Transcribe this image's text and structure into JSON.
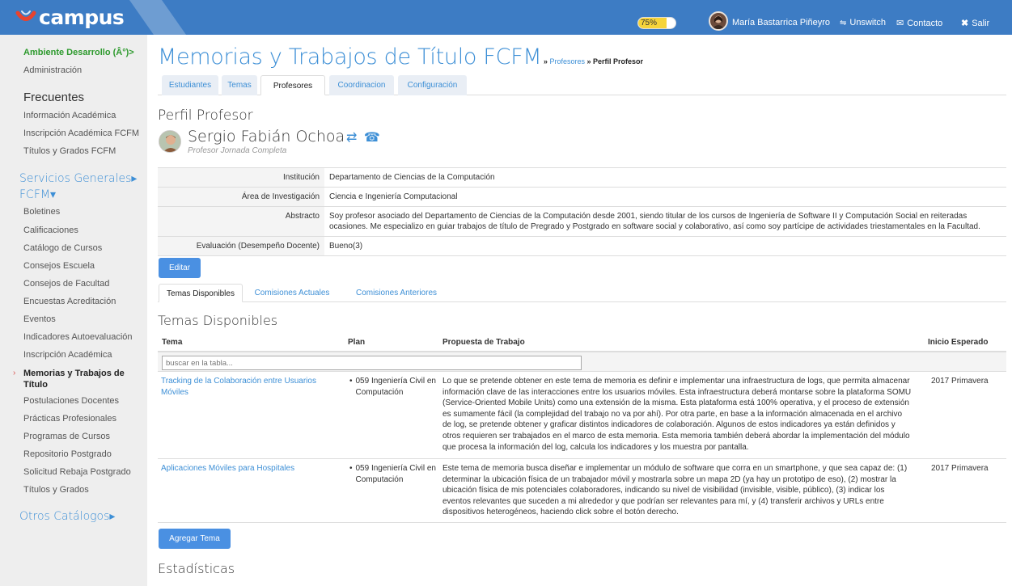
{
  "topbar": {
    "logo_text": "campus",
    "progress": {
      "label": "75%",
      "percent": 75
    },
    "user_name": "María Bastarrica Piñeyro",
    "unswitch_label": "Unswitch",
    "contact_label": "Contacto",
    "exit_label": "Salir",
    "colors": {
      "bar": "#3d7cc4",
      "progress": "#f6d43a"
    }
  },
  "sidebar": {
    "environment": "Ambiente Desarrollo (Â°)>",
    "admin": "Administración",
    "frecuentes_title": "Frecuentes",
    "frecuentes": [
      "Información Académica",
      "Inscripción Académica FCFM",
      "Títulos y Grados FCFM"
    ],
    "servicios_title_1": "Servicios Generales▸",
    "servicios_title_2": "FCFM▾",
    "servicios": [
      "Boletines",
      "Calificaciones",
      "Catálogo de Cursos",
      "Consejos Escuela",
      "Consejos de Facultad",
      "Encuestas Acreditación",
      "Eventos",
      "Indicadores Autoevaluación",
      "Inscripción Académica"
    ],
    "active_item_line1": "Memorias y Trabajos de",
    "active_item_line2": "Título",
    "servicios_after": [
      "Postulaciones Docentes",
      "Prácticas Profesionales",
      "Programas de Cursos",
      "Repositorio Postgrado",
      "Solicitud Rebaja Postgrado",
      "Títulos y Grados"
    ],
    "otros_title": "Otros Catálogos▸"
  },
  "page": {
    "title": "Memorias y Trabajos de Título FCFM",
    "breadcrumb_sep": " » ",
    "breadcrumb_link": "Profesores",
    "breadcrumb_current": "Perfil Profesor",
    "tabs": [
      "Estudiantes",
      "Temas",
      "Profesores",
      "Coordinacion",
      "Configuración"
    ],
    "active_tab": "Profesores"
  },
  "profile": {
    "heading": "Perfil Profesor",
    "name": "Sergio Fabián Ochoa",
    "role": "Profesor Jornada Completa",
    "fields": [
      {
        "label": "Institución",
        "value": "Departamento de Ciencias de la Computación"
      },
      {
        "label": "Área de Investigación",
        "value": "Ciencia e Ingeniería Computacional"
      },
      {
        "label": "Abstracto",
        "value": "Soy profesor asociado del Departamento de Ciencias de la Computación desde 2001, siendo titular de los cursos de Ingeniería de Software II y Computación Social en reiteradas ocasiones. Me especializo en guiar trabajos de título de Pregrado y Postgrado en software social y colaborativo, así como soy partícipe de actividades triestamentales en la Facultad."
      },
      {
        "label": "Evaluación (Desempeño Docente)",
        "value": "Bueno(3)"
      }
    ],
    "edit_label": "Editar"
  },
  "subtabs": [
    "Temas Disponibles",
    "Comisiones Actuales",
    "Comisiones Anteriores"
  ],
  "temas": {
    "heading": "Temas Disponibles",
    "columns": [
      "Tema",
      "Plan",
      "Propuesta de Trabajo",
      "Inicio Esperado"
    ],
    "search_placeholder": "buscar en la tabla...",
    "rows": [
      {
        "tema": "Tracking de la Colaboración entre Usuarios Móviles",
        "plan": "059 Ingeniería Civil en Computación",
        "propuesta": "Lo que se pretende obtener en este tema de memoria es definir e implementar una infraestructura de logs, que permita almacenar información clave de las interacciones entre los usuarios móviles. Esta infraestructura deberá montarse sobre la plataforma SOMU (Service-Oriented Mobile Units) como una extensión de la misma. Esta plataforma está 100% operativa, y el proceso de extensión es sumamente fácil (la complejidad del trabajo no va por ahí). Por otra parte, en base a la información almacenada en el archivo de log, se pretende obtener y graficar distintos indicadores de colaboración. Algunos de estos indicadores ya están definidos y otros requieren ser trabajados en el marco de esta memoria. Esta memoria también deberá abordar la implementación del módulo que procesa la información del log, calcula los indicadores y los muestra por pantalla.",
        "inicio": "2017 Primavera"
      },
      {
        "tema": "Aplicaciones Móviles para Hospitales",
        "plan": "059 Ingeniería Civil en Computación",
        "propuesta": "Este tema de memoria busca diseñar e implementar un módulo de software que corra en un smartphone, y que sea capaz de: (1) determinar la ubicación física de un trabajador móvil y mostrarla sobre un mapa 2D (ya hay un prototipo de eso), (2) mostrar la ubicación física de mis potenciales colaboradores, indicando su nivel de visibilidad (invisible, visible, público), (3) indicar los eventos relevantes que suceden a mi alrededor y que podrían ser relevantes para mí, y (4) transferir archivos y URLs entre dispositivos heterogéneos, haciendo click sobre el botón derecho.",
        "inicio": "2017 Primavera"
      }
    ],
    "add_label": "Agregar Tema"
  },
  "stats": {
    "heading": "Estadísticas"
  }
}
